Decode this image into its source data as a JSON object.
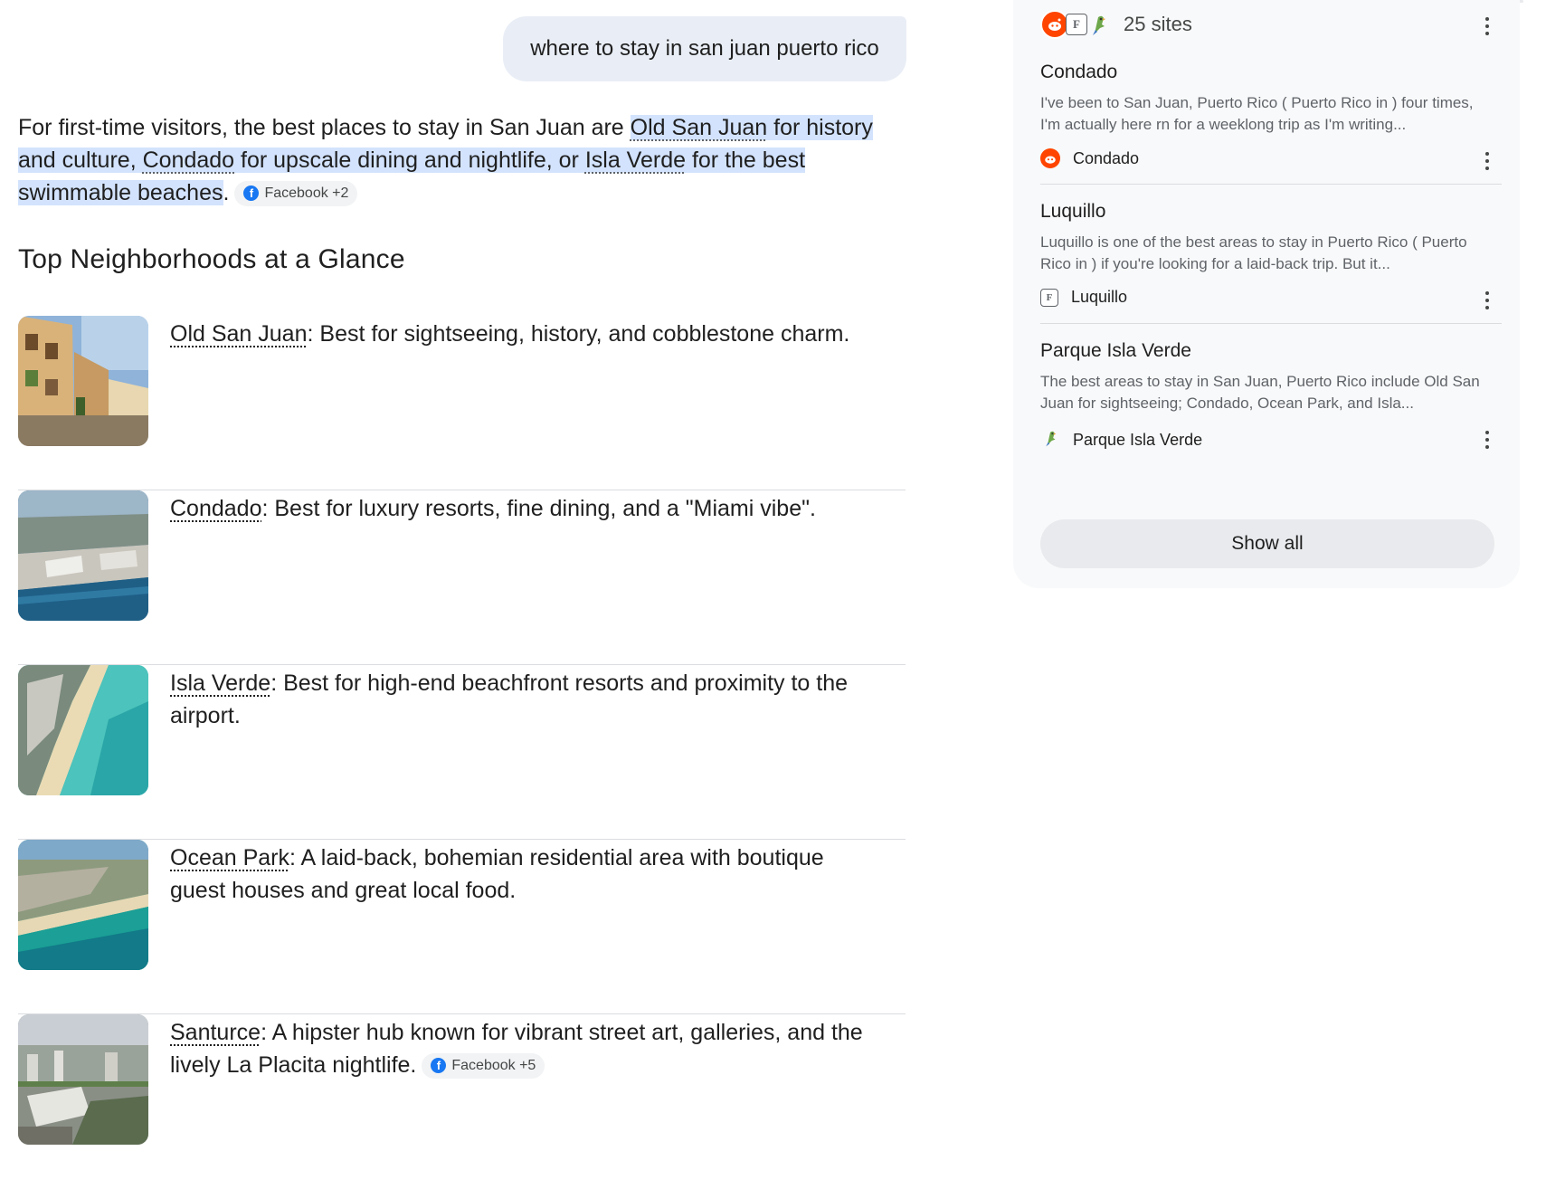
{
  "query": "where to stay in san juan puerto rico",
  "summary": {
    "lead": "For first-time visitors, the best places to stay in San Juan are ",
    "highlight": [
      {
        "text": "Old San Juan",
        "link": true
      },
      {
        "text": " for history and culture, ",
        "link": false
      },
      {
        "text": "Condado",
        "link": true
      },
      {
        "text": " for upscale dining and nightlife, or ",
        "link": false
      },
      {
        "text": "Isla Verde",
        "link": true
      },
      {
        "text": " for the best swimmable beaches",
        "link": false
      }
    ],
    "tail": ".",
    "chip": {
      "icon": "facebook-icon",
      "label": "Facebook +2"
    }
  },
  "section_heading": "Top Neighborhoods at a Glance",
  "neighborhoods": [
    {
      "name": "Old San Juan",
      "desc": ": Best for sightseeing, history, and cobblestone charm.",
      "image": "old-san-juan-street-photo"
    },
    {
      "name": "Condado",
      "desc": ": Best for luxury resorts, fine dining, and a \"Miami vibe\".",
      "image": "condado-aerial-photo"
    },
    {
      "name": "Isla Verde",
      "desc": ": Best for high-end beachfront resorts and proximity to the airport.",
      "image": "isla-verde-beach-aerial-photo"
    },
    {
      "name": "Ocean Park",
      "desc": ": A laid-back, bohemian residential area with boutique guest houses and great local food.",
      "image": "ocean-park-coast-aerial-photo"
    },
    {
      "name": "Santurce",
      "desc": ": A hipster hub known for vibrant street art, galleries, and the lively La Placita nightlife.",
      "image": "santurce-city-aerial-photo",
      "chip": {
        "icon": "facebook-icon",
        "label": "Facebook +5"
      }
    }
  ],
  "sidebar": {
    "sites_count": "25 sites",
    "sources": [
      {
        "title": "Condado",
        "snippet": "I've been to San Juan, Puerto Rico ( Puerto Rico in ) four times, I'm actually here rn for a weeklong trip as I'm writing...",
        "source_name": "Condado",
        "icon": "reddit-icon"
      },
      {
        "title": "Luquillo",
        "snippet": "Luquillo is one of the best areas to stay in Puerto Rico ( Puerto Rico in ) if you're looking for a laid-back trip. But it...",
        "source_name": "Luquillo",
        "icon": "f-site-icon"
      },
      {
        "title": "Parque Isla Verde",
        "snippet": "The best areas to stay in San Juan, Puerto Rico include Old San Juan for sightseeing; Condado, Ocean Park, and Isla...",
        "source_name": "Parque Isla Verde",
        "icon": "parrot-icon"
      }
    ],
    "show_all": "Show all"
  },
  "colors": {
    "highlight": "#d3e3fd",
    "query_bubble": "#e9eef6",
    "sidebar_bg": "#f8f9fa",
    "facebook": "#1877f2",
    "reddit": "#ff4500"
  }
}
